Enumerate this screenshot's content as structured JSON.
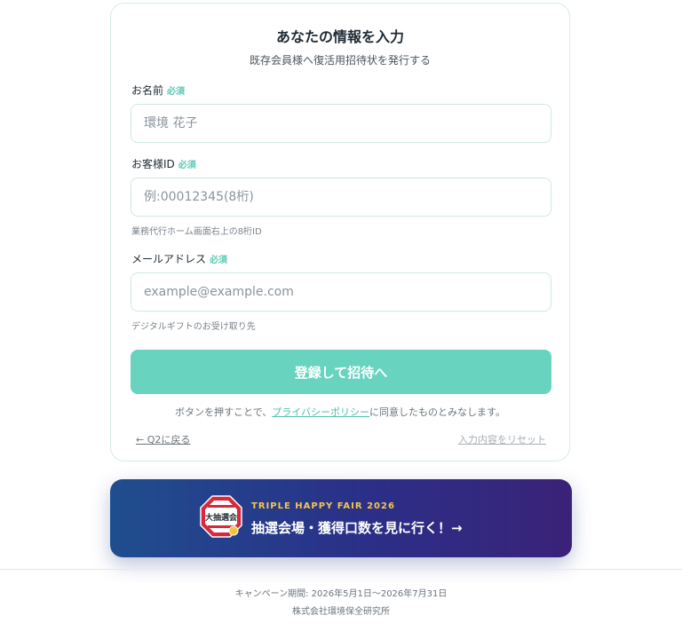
{
  "form": {
    "title": "あなたの情報を入力",
    "subtitle": "既存会員様へ復活用招待状を発行する",
    "required_badge": "必須",
    "name": {
      "label": "お名前",
      "placeholder": "環境 花子"
    },
    "customer_id": {
      "label": "お客様ID",
      "placeholder": "例:00012345(8桁)",
      "hint": "業務代行ホーム画面右上の8桁ID"
    },
    "email": {
      "label": "メールアドレス",
      "placeholder": "example@example.com",
      "hint": "デジタルギフトのお受け取り先"
    },
    "submit_label": "登録して招待へ",
    "consent_prefix": "ボタンを押すことで、",
    "consent_link": "プライバシーポリシー",
    "consent_suffix": "に同意したものとみなします。",
    "back_label": "← Q2に戻る",
    "reset_label": "入力内容をリセット"
  },
  "banner": {
    "kicker": "TRIPLE HAPPY FAIR 2026",
    "main": "抽選会場・獲得口数を見に行く！→",
    "badge_text": "大抽選会",
    "badge_icon": "lottery-badge-icon",
    "colors": {
      "start": "#1f4e8e",
      "end": "#3a2278",
      "kicker": "#f5c64a"
    }
  },
  "footer": {
    "period": "キャンペーン期間: 2026年5月1日〜2026年7月31日",
    "company": "株式会社環境保全研究所"
  },
  "colors": {
    "accent": "#68d3bf",
    "required": "#5ac8b5",
    "link": "#4fbfa9"
  }
}
